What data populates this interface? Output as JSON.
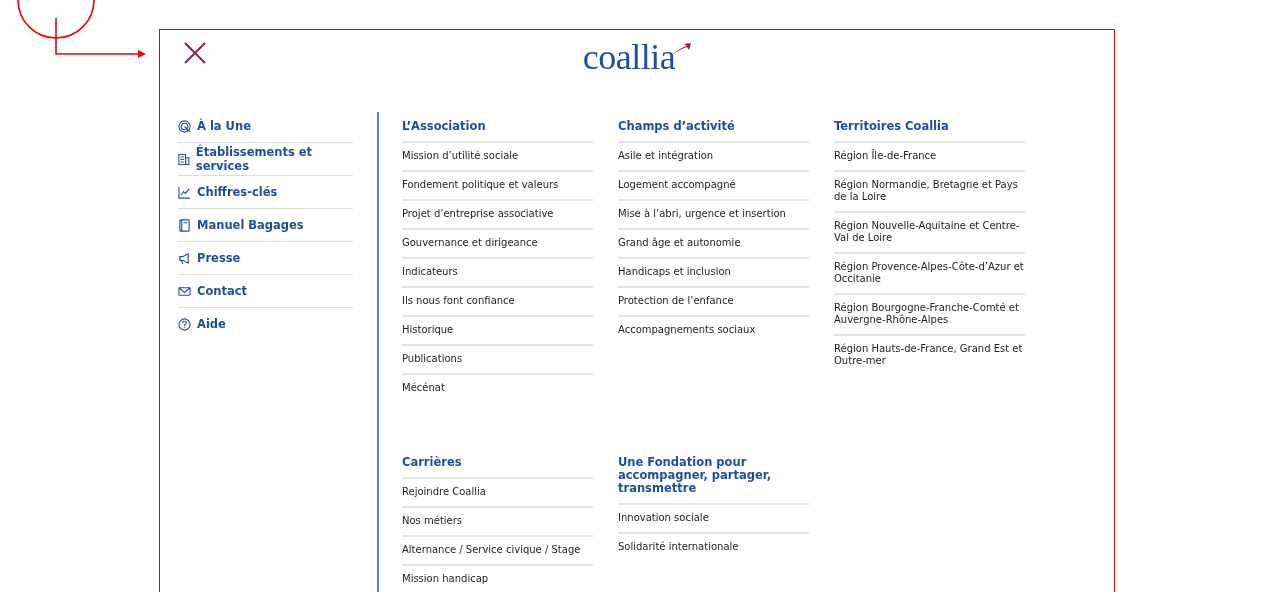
{
  "logo": {
    "text": "coallia"
  },
  "nav": [
    {
      "label": "À la Une"
    },
    {
      "label": "Établissements et services"
    },
    {
      "label": "Chiffres-clés"
    },
    {
      "label": "Manuel Bagages"
    },
    {
      "label": "Presse"
    },
    {
      "label": "Contact"
    },
    {
      "label": "Aide"
    }
  ],
  "sections": [
    {
      "title": "L’Association",
      "links": [
        "Mission d’utilité sociale",
        "Fondement politique et valeurs",
        "Projet d’entreprise associative",
        "Gouvernance et dirigeance",
        "Indicateurs",
        "Ils nous font confiance",
        "Historique",
        "Publications",
        "Mécénat"
      ]
    },
    {
      "title": "Champs d’activité",
      "links": [
        "Asile et intégration",
        "Logement accompagné",
        "Mise à l’abri, urgence et insertion",
        "Grand âge et autonomie",
        "Handicaps et inclusion",
        "Protection de l’enfance",
        "Accompagnements sociaux"
      ]
    },
    {
      "title": "Territoires Coallia",
      "links": [
        "Région Île-de-France",
        "Région Normandie, Bretagne et Pays de la Loire",
        "Région Nouvelle-Aquitaine et Centre-Val de Loire",
        "Région Provence-Alpes-Côte-d’Azur et Occitanie",
        "Région Bourgogne-Franche-Comté et Auvergne-Rhône-Alpes",
        "Région Hauts-de-France, Grand Est et Outre-mer"
      ]
    },
    {
      "title": "Carrières",
      "links": [
        "Rejoindre Coallia",
        "Nos métiers",
        "Alternance / Service civique / Stage",
        "Mission handicap"
      ]
    },
    {
      "title": "Une Fondation pour accompagner, partager, transmettre",
      "links": [
        "Innovation sociale",
        "Solidarité internationale"
      ]
    }
  ]
}
